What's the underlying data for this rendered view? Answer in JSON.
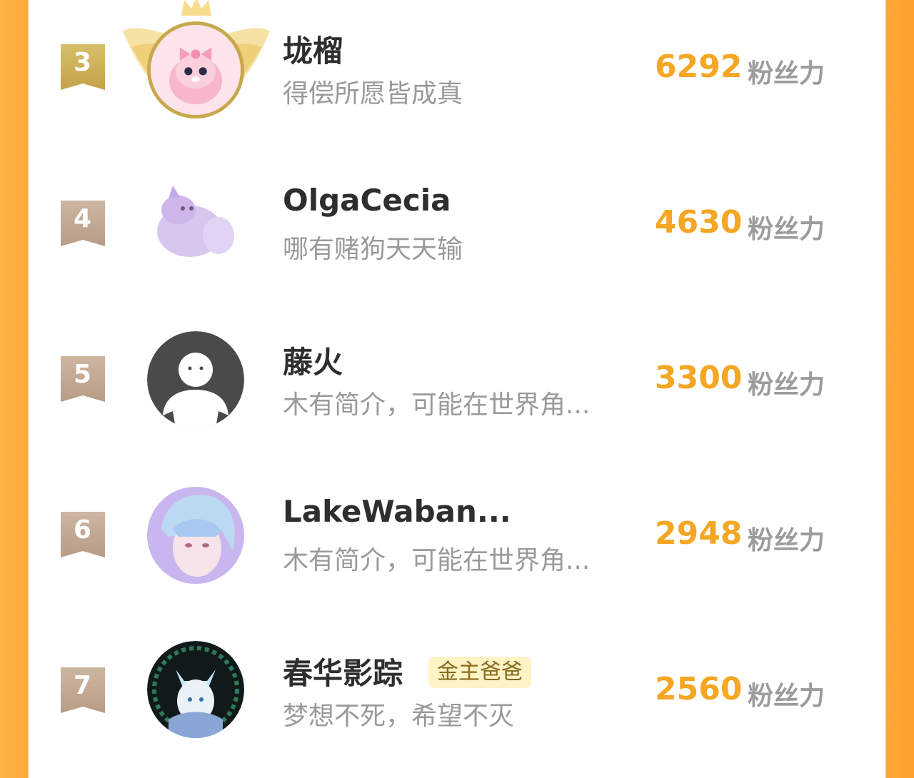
{
  "unit_label": "粉丝力",
  "colors": {
    "accent": "#f5a623",
    "name": "#2e2e2e",
    "subtitle": "#9a9a9a",
    "rank_gold": "#cdb05a",
    "rank_standard": "#c4ab96",
    "side_bar": "#ffa93a"
  },
  "rankings": [
    {
      "rank": "3",
      "name": "垅榴",
      "subtitle": "得偿所愿皆成真",
      "score": "6292",
      "avatar": "pink-bunny-avatar"
    },
    {
      "rank": "4",
      "name": "OlgaCecia",
      "subtitle": "哪有赌狗天天输",
      "score": "4630",
      "avatar": "purple-cat-avatar"
    },
    {
      "rank": "5",
      "name": "藤火",
      "subtitle": "木有简介，可能在世界角...",
      "score": "3300",
      "avatar": "default-silhouette-avatar"
    },
    {
      "rank": "6",
      "name": "LakeWaban...",
      "subtitle": "木有简介，可能在世界角...",
      "score": "2948",
      "avatar": "anime-boy-avatar"
    },
    {
      "rank": "7",
      "name": "春华影踪",
      "badge": "金主爸爸",
      "subtitle": "梦想不死，希望不灭",
      "score": "2560",
      "avatar": "fox-spirit-avatar"
    }
  ]
}
